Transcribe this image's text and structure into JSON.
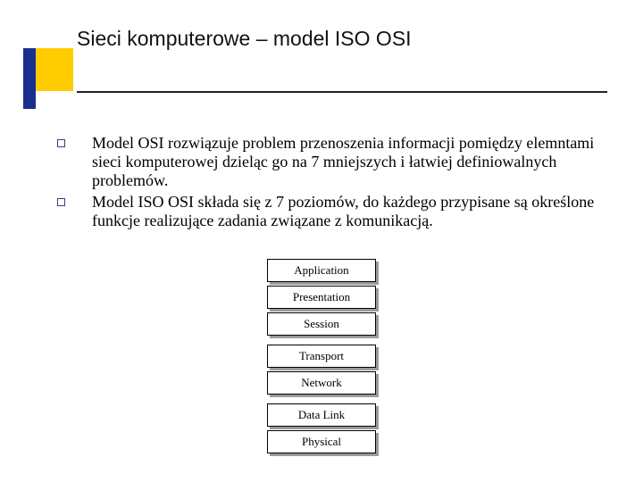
{
  "title": "Sieci komputerowe – model ISO OSI",
  "bullets": [
    "Model OSI rozwiązuje problem przenoszenia informacji pomiędzy elemntami sieci komputerowej dzieląc go na 7 mniejszych i łatwiej definiowalnych problemów.",
    "Model ISO OSI składa się z 7 poziomów, do każdego przypisane są określone funkcje realizujące zadania związane z komunikacją."
  ],
  "layers": {
    "group1": [
      "Application",
      "Presentation",
      "Session"
    ],
    "group2": [
      "Transport",
      "Network"
    ],
    "group3": [
      "Data Link",
      "Physical"
    ]
  }
}
